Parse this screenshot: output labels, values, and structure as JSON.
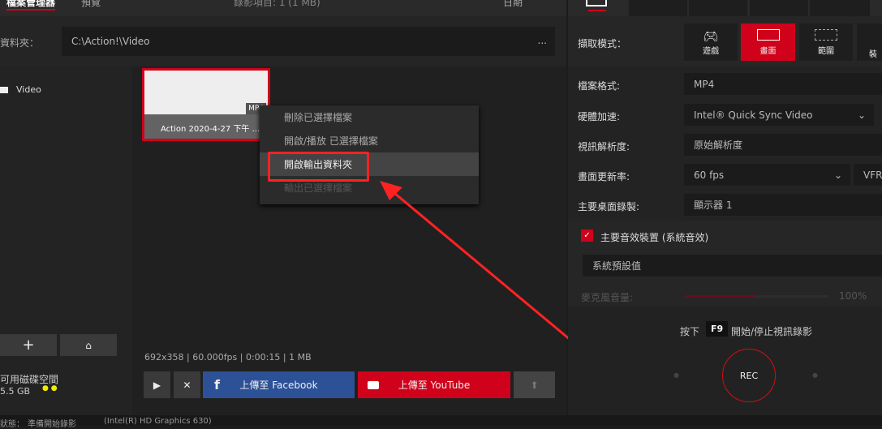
{
  "top": {
    "tab_files": "檔案管理器",
    "tab_preview": "預覽",
    "record_count": "錄影項目: 1 (1 MB)",
    "sort": "日期"
  },
  "folder": {
    "label": "資料夾：",
    "path": "C:\\Action!\\Video",
    "more": "..."
  },
  "sidebar": {
    "item": "Video",
    "disk_label": "可用磁碟空間",
    "disk_value": "5.5 GB"
  },
  "thumb": {
    "title": "Action 2020-4-27 下午 ...",
    "badge": "MP4"
  },
  "context_menu": [
    "刪除已選擇檔案",
    "開啟/播放 已選擇檔案",
    "開啟輸出資料夾",
    "輸出已選擇檔案"
  ],
  "info": "692x358 | 60.000fps | 0:00:15 | 1 MB",
  "upload": {
    "facebook": "上傳至 Facebook",
    "youtube": "上傳至 YouTube"
  },
  "right": {
    "capture_label": "擷取模式：",
    "modes": [
      "遊戲",
      "畫面",
      "範圍",
      "裝"
    ],
    "settings": [
      {
        "label": "檔案格式:",
        "value": "MP4"
      },
      {
        "label": "硬體加速:",
        "value": "Intel® Quick Sync Video"
      },
      {
        "label": "視訊解析度:",
        "value": "原始解析度"
      },
      {
        "label": "畫面更新率:",
        "value": "60 fps",
        "extra": "VFR"
      },
      {
        "label": "主要桌面錄製:",
        "value": "顯示器 1"
      }
    ],
    "audio_label": "主要音效裝置 (系統音效)",
    "audio_device": "系統預設值",
    "mic_label": "麥克風音量:",
    "mic_value": "100%",
    "mic_level": 0.5,
    "hotkey_pre": "按下",
    "hotkey": "F9",
    "hotkey_post": "開始/停止視訊錄影",
    "rec": "REC"
  },
  "status": {
    "label": "狀態：",
    "text": "準備開始錄影",
    "gpu": "(Intel(R) HD Graphics 630)"
  },
  "colors": {
    "accent": "#d0021b",
    "facebook": "#2d5196"
  }
}
